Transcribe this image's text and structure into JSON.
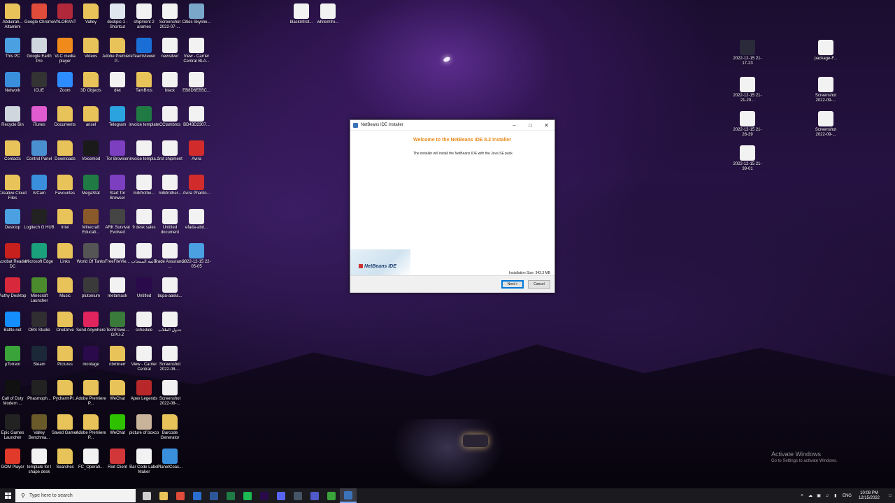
{
  "desktop_icons": [
    {
      "label": "Abdulrah... Altamimi",
      "icon": "folder-icon",
      "color": "#e8c35a"
    },
    {
      "label": "Google Chrome",
      "icon": "chrome-icon",
      "color": "#e04b3a"
    },
    {
      "label": "VALORANT",
      "icon": "valorant-icon",
      "color": "#b0283a"
    },
    {
      "label": "Valley",
      "icon": "folder-icon",
      "color": "#e8c35a"
    },
    {
      "label": "deskpic-1 - Shortcut",
      "icon": "file-icon",
      "color": "#dfe6ee"
    },
    {
      "label": "shipment 2 aramex",
      "icon": "file-icon",
      "color": "#f2f2f2"
    },
    {
      "label": "Screenshot 2022-07-...",
      "icon": "image-icon",
      "color": "#f2f2f2"
    },
    {
      "label": "Cities Skyline...",
      "icon": "game-icon",
      "color": "#7aa6c9"
    },
    {
      "label": "This PC",
      "icon": "computer-icon",
      "color": "#4aa0e0"
    },
    {
      "label": "Google Earth Pro",
      "icon": "earth-icon",
      "color": "#cfd6de"
    },
    {
      "label": "VLC media player",
      "icon": "vlc-icon",
      "color": "#f08a1a"
    },
    {
      "label": "Videos",
      "icon": "folder-icon",
      "color": "#e8c35a"
    },
    {
      "label": "Adobe Premiere P...",
      "icon": "folder-icon",
      "color": "#e8c35a"
    },
    {
      "label": "TeamViewer",
      "icon": "teamviewer-icon",
      "color": "#1a6fd6"
    },
    {
      "label": "newsilver",
      "icon": "file-icon",
      "color": "#f2f2f2"
    },
    {
      "label": "View - Carrier Central BLA...",
      "icon": "file-icon",
      "color": "#f2f2f2"
    },
    {
      "label": "Network",
      "icon": "network-icon",
      "color": "#3a8fdc"
    },
    {
      "label": "iCUE",
      "icon": "icue-icon",
      "color": "#333"
    },
    {
      "label": "Zoom",
      "icon": "zoom-icon",
      "color": "#2d8cff"
    },
    {
      "label": "3D Objects",
      "icon": "folder-icon",
      "color": "#e8c35a"
    },
    {
      "label": "diet",
      "icon": "file-icon",
      "color": "#f2f2f2"
    },
    {
      "label": "TamBros",
      "icon": "folder-icon",
      "color": "#e8c35a"
    },
    {
      "label": "black",
      "icon": "file-icon",
      "color": "#f2f2f2"
    },
    {
      "label": "EB8D6EB5C...",
      "icon": "file-icon",
      "color": "#f2f2f2"
    },
    {
      "label": "Recycle Bin",
      "icon": "recycle-bin-icon",
      "color": "#cfd6de"
    },
    {
      "label": "iTunes",
      "icon": "itunes-icon",
      "color": "#e05bd0"
    },
    {
      "label": "Documents",
      "icon": "folder-icon",
      "color": "#e8c35a"
    },
    {
      "label": "ansel",
      "icon": "folder-icon",
      "color": "#e8c35a"
    },
    {
      "label": "Telegram",
      "icon": "telegram-icon",
      "color": "#2aa3de"
    },
    {
      "label": "invoice template",
      "icon": "excel-icon",
      "color": "#1f7a44"
    },
    {
      "label": "CCtambros",
      "icon": "file-icon",
      "color": "#f2f2f2"
    },
    {
      "label": "BD43D2307...",
      "icon": "file-icon",
      "color": "#f2f2f2"
    },
    {
      "label": "Contacts",
      "icon": "folder-icon",
      "color": "#e8c35a"
    },
    {
      "label": "Control Panel",
      "icon": "control-panel-icon",
      "color": "#4a8fd0"
    },
    {
      "label": "Downloads",
      "icon": "folder-icon",
      "color": "#e8c35a"
    },
    {
      "label": "Voicemod",
      "icon": "voicemod-icon",
      "color": "#1a1a1a"
    },
    {
      "label": "Tor Browser",
      "icon": "tor-icon",
      "color": "#7b3fbf"
    },
    {
      "label": "invoice templa...",
      "icon": "file-icon",
      "color": "#f2f2f2"
    },
    {
      "label": "first shipment",
      "icon": "file-icon",
      "color": "#f2f2f2"
    },
    {
      "label": "Avira",
      "icon": "avira-icon",
      "color": "#d12b2b"
    },
    {
      "label": "Creative Cloud Files",
      "icon": "folder-icon",
      "color": "#e8c35a"
    },
    {
      "label": "iVCam",
      "icon": "ivcam-icon",
      "color": "#3a8fdc"
    },
    {
      "label": "Favourites",
      "icon": "folder-icon",
      "color": "#e8c35a"
    },
    {
      "label": "MegaStat",
      "icon": "excel-icon",
      "color": "#1f7a44"
    },
    {
      "label": "Start Tor Browser",
      "icon": "tor-icon",
      "color": "#7b3fbf"
    },
    {
      "label": "milkfrothe...",
      "icon": "file-icon",
      "color": "#f2f2f2"
    },
    {
      "label": "milkfrother...",
      "icon": "file-icon",
      "color": "#f2f2f2"
    },
    {
      "label": "Avira Phanto...",
      "icon": "avira-phantom-icon",
      "color": "#d12b2b"
    },
    {
      "label": "Desktop",
      "icon": "desktop-icon",
      "color": "#4aa0e0"
    },
    {
      "label": "Logitech G HUB",
      "icon": "logitech-icon",
      "color": "#222"
    },
    {
      "label": "Intel",
      "icon": "folder-icon",
      "color": "#e8c35a"
    },
    {
      "label": "Minecraft Educati...",
      "icon": "minecraft-icon",
      "color": "#8b5a2b"
    },
    {
      "label": "ARK Survival Evolved",
      "icon": "ark-icon",
      "color": "#444"
    },
    {
      "label": "9 desk sales",
      "icon": "file-icon",
      "color": "#f2f2f2"
    },
    {
      "label": "Untitled document",
      "icon": "file-icon",
      "color": "#f2f2f2"
    },
    {
      "label": "efada-abd...",
      "icon": "file-icon",
      "color": "#f2f2f2"
    },
    {
      "label": "Acrobat Reader DC",
      "icon": "acrobat-icon",
      "color": "#c8201c"
    },
    {
      "label": "Microsoft Edge",
      "icon": "edge-icon",
      "color": "#1aa07a"
    },
    {
      "label": "Links",
      "icon": "folder-icon",
      "color": "#e8c35a"
    },
    {
      "label": "World Of Tanks",
      "icon": "tanks-icon",
      "color": "#555"
    },
    {
      "label": "FreeFileVie...",
      "icon": "file-icon",
      "color": "#f2f2f2"
    },
    {
      "label": "قائمة المنتجات",
      "icon": "file-icon",
      "color": "#f2f2f2"
    },
    {
      "label": "Trade Assurance ...",
      "icon": "file-icon",
      "color": "#f2f2f2"
    },
    {
      "label": "2022-12-15 22-05-05",
      "icon": "video-icon",
      "color": "#4aa0e0"
    },
    {
      "label": "Authy Desktop",
      "icon": "authy-icon",
      "color": "#d8283b"
    },
    {
      "label": "Minecraft Launcher",
      "icon": "minecraft-icon",
      "color": "#4c8a2e"
    },
    {
      "label": "Music",
      "icon": "folder-icon",
      "color": "#e8c35a"
    },
    {
      "label": "plutonium",
      "icon": "plutonium-icon",
      "color": "#3a3a3a"
    },
    {
      "label": "metamask",
      "icon": "file-icon",
      "color": "#f2f2f2"
    },
    {
      "label": "Untitled",
      "icon": "premiere-icon",
      "color": "#2a0a4a"
    },
    {
      "label": "bupa-aaela...",
      "icon": "file-icon",
      "color": "#f2f2f2"
    },
    {
      "label": "Battle.net",
      "icon": "battlenet-icon",
      "color": "#148eff"
    },
    {
      "label": "OBS Studio",
      "icon": "obs-icon",
      "color": "#302e31"
    },
    {
      "label": "OneDrive",
      "icon": "folder-icon",
      "color": "#e8c35a"
    },
    {
      "label": "Send Anywhere",
      "icon": "send-anywhere-icon",
      "color": "#e0245e"
    },
    {
      "label": "TechPowe... GPU-Z",
      "icon": "gpuz-icon",
      "color": "#3a7a3a"
    },
    {
      "label": "schedule",
      "icon": "file-icon",
      "color": "#f2f2f2"
    },
    {
      "label": "جدول الطلاب",
      "icon": "file-icon",
      "color": "#f2f2f2"
    },
    {
      "label": "µTorrent",
      "icon": "utorrent-icon",
      "color": "#3aa33a"
    },
    {
      "label": "Steam",
      "icon": "steam-icon",
      "color": "#1b2838"
    },
    {
      "label": "Pictures",
      "icon": "folder-icon",
      "color": "#e8c35a"
    },
    {
      "label": "montage",
      "icon": "premiere-icon",
      "color": "#2a0a4a"
    },
    {
      "label": "nbminerr",
      "icon": "folder-icon",
      "color": "#e8c35a"
    },
    {
      "label": "View - Carrier Central",
      "icon": "file-icon",
      "color": "#f2f2f2"
    },
    {
      "label": "Screenshot 2022-08-...",
      "icon": "image-icon",
      "color": "#f2f2f2"
    },
    {
      "label": "Call of Duty Modern ...",
      "icon": "cod-icon",
      "color": "#111"
    },
    {
      "label": "Phasmoph...",
      "icon": "phasmophobia-icon",
      "color": "#222"
    },
    {
      "label": "PycharmPr...",
      "icon": "folder-icon",
      "color": "#e8c35a"
    },
    {
      "label": "Adobe Premiere P...",
      "icon": "premiere-file-icon",
      "color": "#e8c35a"
    },
    {
      "label": "WeChat",
      "icon": "folder-icon",
      "color": "#e8c35a"
    },
    {
      "label": "Apex Legends",
      "icon": "apex-icon",
      "color": "#b8282b"
    },
    {
      "label": "Screenshot 2022-08-...",
      "icon": "image-icon",
      "color": "#f2f2f2"
    },
    {
      "label": "Epic Games Launcher",
      "icon": "epic-icon",
      "color": "#222"
    },
    {
      "label": "Valley Benchma...",
      "icon": "valley-icon",
      "color": "#6a5a2a"
    },
    {
      "label": "Saved Games",
      "icon": "folder-icon",
      "color": "#e8c35a"
    },
    {
      "label": "Adobe Premiere P...",
      "icon": "folder-icon",
      "color": "#e8c35a"
    },
    {
      "label": "WeChat",
      "icon": "wechat-icon",
      "color": "#2dc100"
    },
    {
      "label": "picture of boxco",
      "icon": "photo-icon",
      "color": "#c9b39a"
    },
    {
      "label": "Barcode Generator",
      "icon": "folder-icon",
      "color": "#e8c35a"
    },
    {
      "label": "GOM Player",
      "icon": "gom-icon",
      "color": "#e23a2a"
    },
    {
      "label": "template for l shape desk",
      "icon": "file-icon",
      "color": "#f2f2f2"
    },
    {
      "label": "Searches",
      "icon": "folder-icon",
      "color": "#e8c35a"
    },
    {
      "label": "FC_Operati...",
      "icon": "file-icon",
      "color": "#f2f2f2"
    },
    {
      "label": "Riot Client",
      "icon": "riot-icon",
      "color": "#d13639"
    },
    {
      "label": "Bar Code Label Maker",
      "icon": "barcode-icon",
      "color": "#f2f2f2"
    },
    {
      "label": "PlanetCoas...",
      "icon": "planetcoaster-icon",
      "color": "#3a8fdc"
    },
    {
      "label": "blackmfrot...",
      "icon": "file-icon",
      "color": "#f2f2f2"
    },
    {
      "label": "whitemfro...",
      "icon": "file-icon",
      "color": "#f2f2f2"
    },
    {
      "label": "2022-12-15 21-17-23",
      "icon": "video-icon",
      "color": "#2a2a3a"
    },
    {
      "label": "package-F...",
      "icon": "file-icon",
      "color": "#f2f2f2"
    },
    {
      "label": "2022-12-15 21-21-20...",
      "icon": "image-icon",
      "color": "#f2f2f2"
    },
    {
      "label": "Screenshot 2022-09-...",
      "icon": "image-icon",
      "color": "#f2f2f2"
    },
    {
      "label": "2022-12-15 21-28-39",
      "icon": "image-icon",
      "color": "#f2f2f2"
    },
    {
      "label": "Screenshot 2022-09-...",
      "icon": "image-icon",
      "color": "#f2f2f2"
    },
    {
      "label": "2022-12-15 21-39-01",
      "icon": "image-icon",
      "color": "#f2f2f2"
    }
  ],
  "installer": {
    "window_title": "NetBeans IDE Installer",
    "welcome_title": "Welcome to the NetBeans IDE 8.2 Installer",
    "description": "The installer will install the NetBeans IDE with the Java SE pack.",
    "brand": "NetBeans IDE",
    "installation_size": "Installation Size: 343.3 MB",
    "next_label": "Next >",
    "cancel_label": "Cancel",
    "accent_color": "#e88a1a"
  },
  "watermark": {
    "line1": "Activate Windows",
    "line2": "Go to Settings to activate Windows."
  },
  "taskbar": {
    "search_placeholder": "Type here to search",
    "apps": [
      {
        "name": "task-view-icon",
        "color": "#cfcfcf"
      },
      {
        "name": "file-explorer-icon",
        "color": "#e8c35a"
      },
      {
        "name": "chrome-icon",
        "color": "#e04b3a"
      },
      {
        "name": "mail-icon",
        "color": "#2a6fd0"
      },
      {
        "name": "word-icon",
        "color": "#2b5797"
      },
      {
        "name": "excel-icon",
        "color": "#1f7a44"
      },
      {
        "name": "spotify-icon",
        "color": "#1db954"
      },
      {
        "name": "premiere-icon",
        "color": "#2a0a4a"
      },
      {
        "name": "discord-icon",
        "color": "#5865f2"
      },
      {
        "name": "steam-icon",
        "color": "#445566"
      },
      {
        "name": "teams-icon",
        "color": "#5059c9"
      },
      {
        "name": "utorrent-icon",
        "color": "#3aa33a"
      },
      {
        "name": "netbeans-icon",
        "color": "#3b73b9",
        "active": true
      }
    ],
    "language": "ENG",
    "time": "10:08 PM",
    "date": "12/15/2022"
  }
}
